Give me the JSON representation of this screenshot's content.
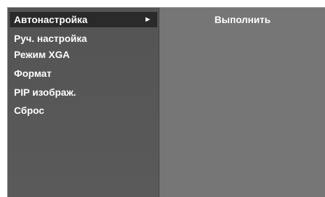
{
  "menu": {
    "items": [
      {
        "label": "Автонастройка",
        "selected": true,
        "icon": "arrow-right-icon",
        "arrow": "►"
      },
      {
        "label": "Руч. настройка",
        "selected": false
      },
      {
        "label": "Режим XGA",
        "selected": false
      },
      {
        "label": "Формат",
        "selected": false
      },
      {
        "label": "PIP изображ.",
        "selected": false
      },
      {
        "label": "Сброс",
        "selected": false
      }
    ]
  },
  "submenu": {
    "items": [
      {
        "label": "Выполнить"
      }
    ]
  },
  "colors": {
    "panel_background": "#777777",
    "menu_background": "#575757",
    "selected_highlight": "#2a2a2a",
    "text": "#ffffff"
  }
}
